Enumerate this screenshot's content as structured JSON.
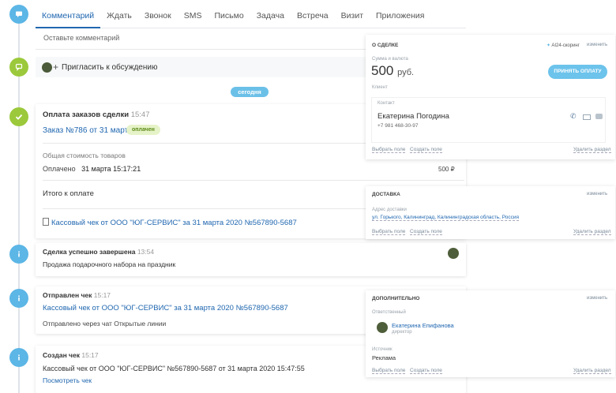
{
  "tabs": [
    "Комментарий",
    "Ждать",
    "Звонок",
    "SMS",
    "Письмо",
    "Задача",
    "Встреча",
    "Визит",
    "Приложения"
  ],
  "comment_placeholder": "Оставьте комментарий",
  "invite_label": "Пригласить к обсуждению",
  "today_label": "сегодня",
  "payment": {
    "title": "Оплата заказов сделки",
    "time": "15:47",
    "order_link": "Заказ №786 от 31 марта",
    "badge": "оплачен",
    "total_label": "Общая стоимость товаров",
    "paid_label": "Оплачено",
    "paid_date": "31 марта 15:17:21",
    "paid_amount": "500 ₽",
    "due_label": "Итого к оплате",
    "receipt_link": "Кассовый чек от ООО \"ЮГ-СЕРВИС\" за 31 марта 2020 №567890-5687"
  },
  "deal_done": {
    "title": "Сделка успешно завершена",
    "time": "13:54",
    "text": "Продажа подарочного набора на праздник"
  },
  "receipt_sent": {
    "title": "Отправлен чек",
    "time": "15:17",
    "link": "Кассовый чек от ООО \"ЮГ-СЕРВИС\" за 31 марта 2020 №567890-5687",
    "text": "Отправлено через чат Открытые линии"
  },
  "receipt_created": {
    "title": "Создан чек",
    "time": "15:17",
    "text": "Кассовый чек от ООО \"ЮГ-СЕРВИС\" №567890-5687 от 31 марта 2020 15:47:55",
    "link": "Посмотреть чек"
  },
  "deal_panel": {
    "header": "О СДЕЛКЕ",
    "scoring": "AI24-скоринг",
    "edit": "изменить",
    "sum_label": "Сумма и валюта",
    "amount": "500",
    "currency": "руб.",
    "pay_button": "ПРИНЯТЬ ОПЛАТУ",
    "client_label": "Клиент",
    "contact_label": "Контакт",
    "contact_name": "Екатерина Погодина",
    "contact_phone": "+7 981 468-30-97",
    "select_field": "Выбрать поле",
    "create_field": "Создать поле",
    "delete_section": "Удалить раздел"
  },
  "delivery_panel": {
    "header": "ДОСТАВКА",
    "edit": "изменить",
    "address_label": "Адрес доставки",
    "address": "ул. Горького, Калининград, Калининградская область, Россия",
    "select_field": "Выбрать поле",
    "create_field": "Создать поле",
    "delete_section": "Удалить раздел"
  },
  "extra_panel": {
    "header": "ДОПОЛНИТЕЛЬНО",
    "edit": "изменить",
    "responsible_label": "Ответственный",
    "responsible_name": "Екатерина Епифанова",
    "responsible_role": "директор",
    "source_label": "Источник",
    "source_value": "Реклама",
    "select_field": "Выбрать поле",
    "create_field": "Создать поле",
    "delete_section": "Удалить раздел"
  },
  "colors": {
    "accent": "#2067b0",
    "timeline_blue": "#5cb6e6",
    "timeline_green": "#9bc93b",
    "pay_button": "#6cc3eb"
  }
}
